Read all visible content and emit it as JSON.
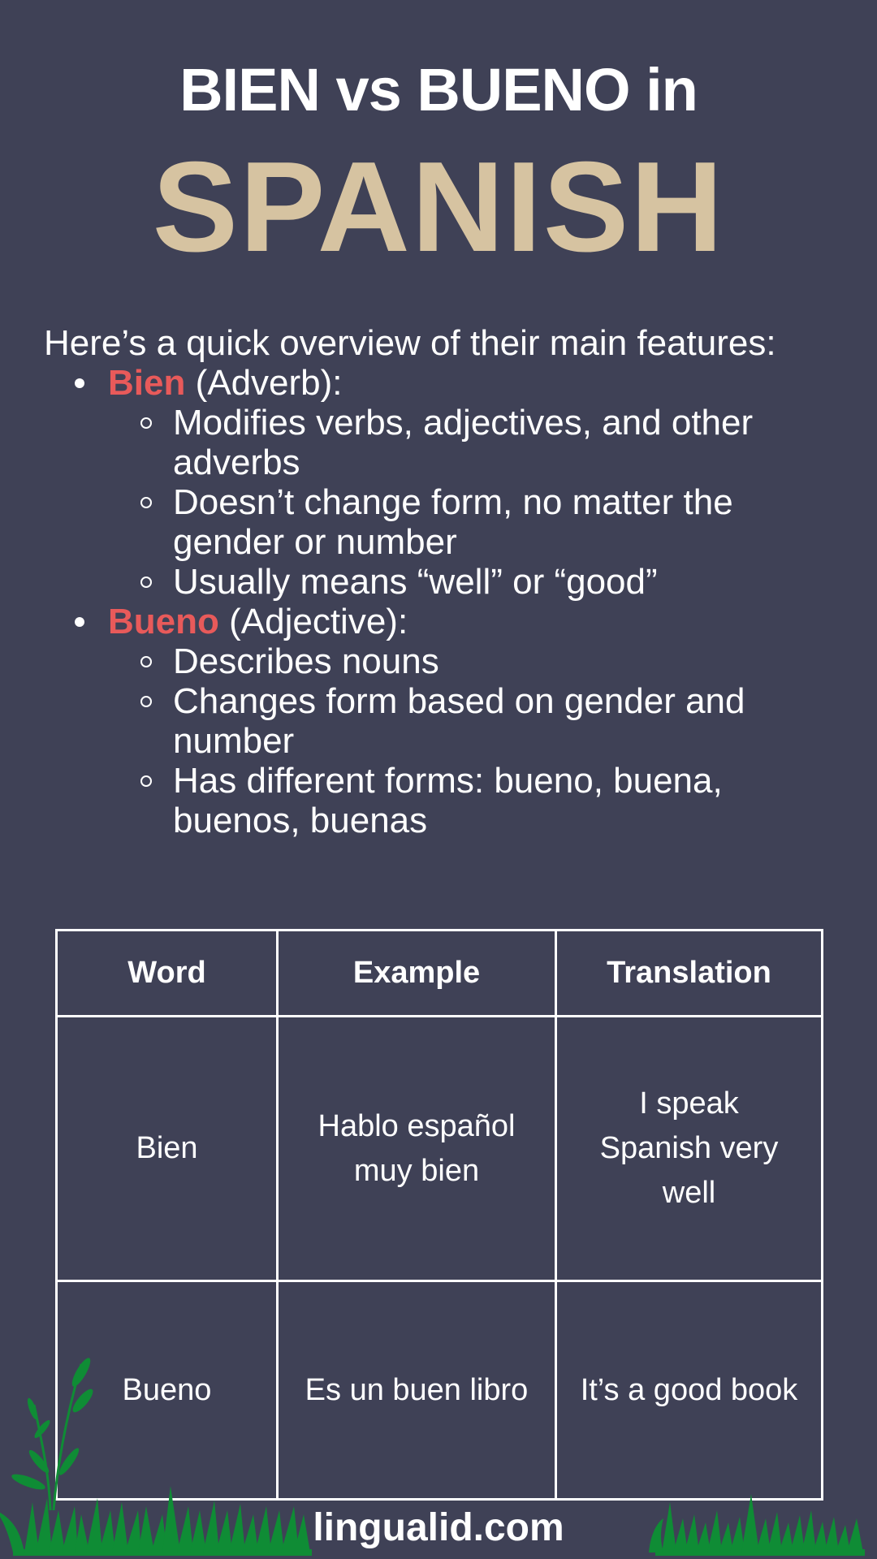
{
  "header": {
    "title": "BIEN vs BUENO in",
    "subtitle": "SPANISH"
  },
  "colors": {
    "background": "#3f4156",
    "accent_tan": "#d6c3a1",
    "keyword_red": "#e85a5a",
    "grass_green": "#0f8c35"
  },
  "intro": {
    "text": "Here’s a quick overview of their main features:",
    "items": [
      {
        "keyword": "Bien",
        "type": " (Adverb):",
        "points": [
          "Modifies verbs, adjectives, and other adverbs",
          "Doesn’t change form, no matter the gender or number",
          "Usually means “well” or “good”"
        ]
      },
      {
        "keyword": "Bueno",
        "type": " (Adjective):",
        "points": [
          "Describes nouns",
          "Changes form based on gender and number",
          "Has different forms: bueno, buena, buenos, buenas"
        ]
      }
    ]
  },
  "table": {
    "headers": [
      "Word",
      "Example",
      "Translation"
    ],
    "rows": [
      [
        "Bien",
        "Hablo español muy bien",
        "I speak Spanish very well"
      ],
      [
        "Bueno",
        "Es un buen libro",
        "It’s a good book"
      ]
    ]
  },
  "footer": {
    "site": "lingualid.com"
  },
  "decorations": {
    "left": "grass-and-plant-icon",
    "right": "grass-icon"
  }
}
